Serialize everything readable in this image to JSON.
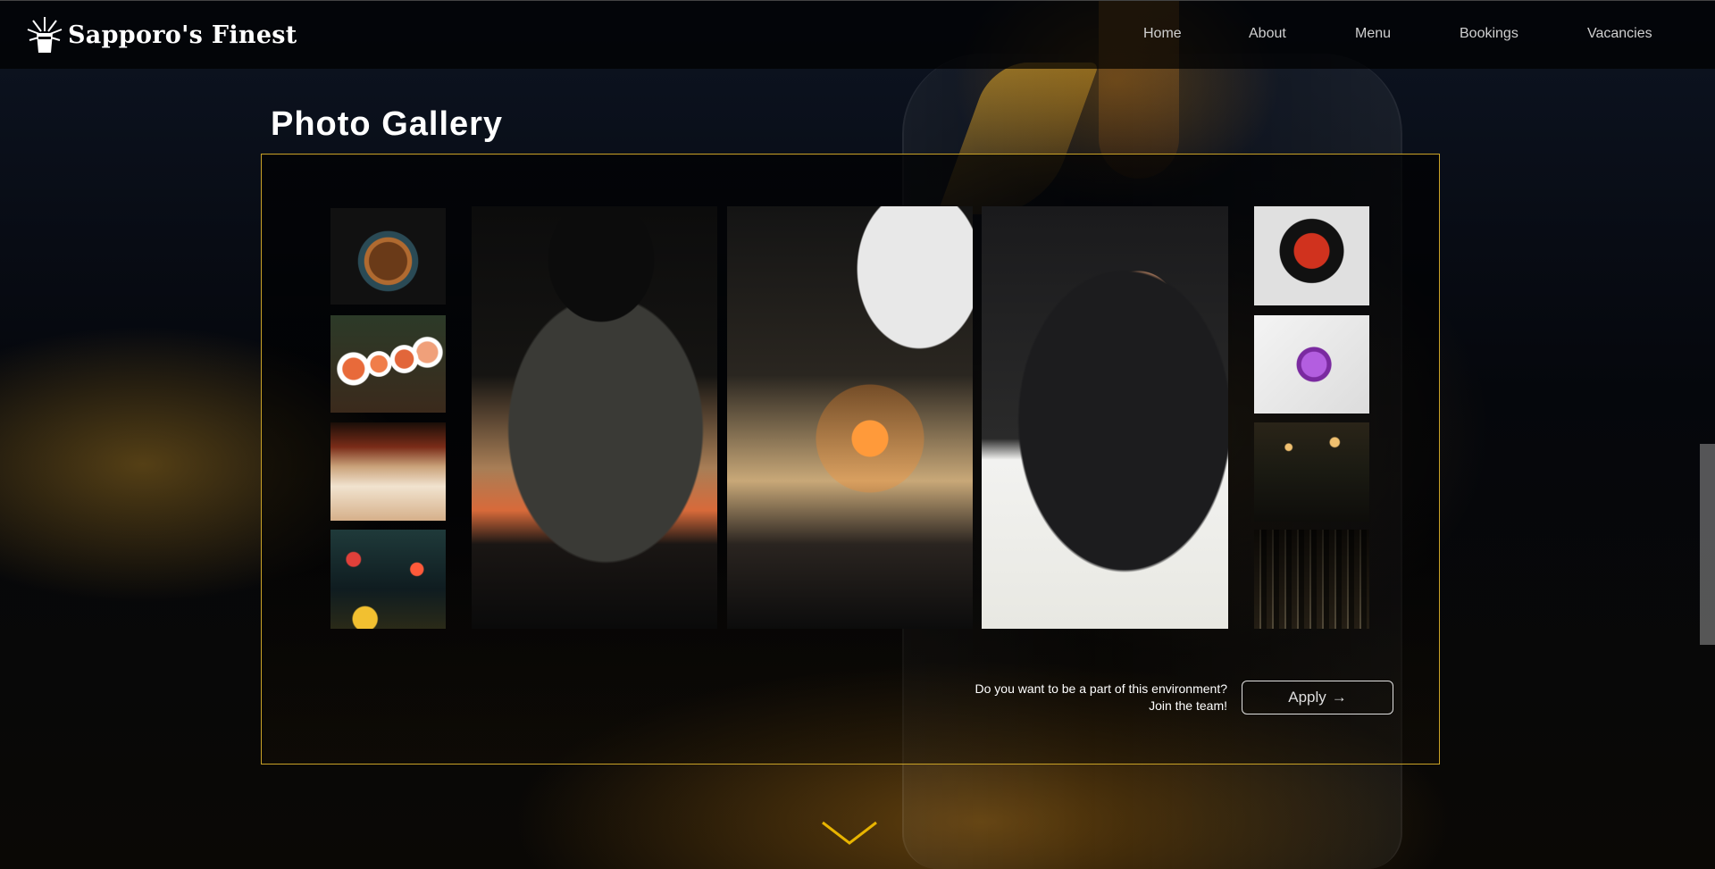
{
  "brand": {
    "name": "Sapporo's Finest",
    "logo_icon": "burst-glass-icon"
  },
  "nav": {
    "items": [
      {
        "label": "Home"
      },
      {
        "label": "About"
      },
      {
        "label": "Menu"
      },
      {
        "label": "Bookings"
      },
      {
        "label": "Vacancies"
      }
    ]
  },
  "gallery": {
    "title": "Photo Gallery",
    "accent_color": "#c9a227",
    "left_thumbs": [
      {
        "subject": "ramen bowl"
      },
      {
        "subject": "sushi rolls"
      },
      {
        "subject": "restaurant counter"
      },
      {
        "subject": "night alley"
      }
    ],
    "feature_photos": [
      {
        "subject": "chef plating at counter"
      },
      {
        "subject": "torching sushi"
      },
      {
        "subject": "chef rolling sushi"
      }
    ],
    "right_thumbs": [
      {
        "subject": "prawn bowl"
      },
      {
        "subject": "purple dessert"
      },
      {
        "subject": "dining room"
      },
      {
        "subject": "bar shelves"
      }
    ]
  },
  "recruit": {
    "line1": "Do you want to be a part of this environment?",
    "line2": "Join the team!",
    "apply_label": "Apply",
    "apply_arrow": "→"
  },
  "scroll_indicator_icon": "chevron-down-icon"
}
